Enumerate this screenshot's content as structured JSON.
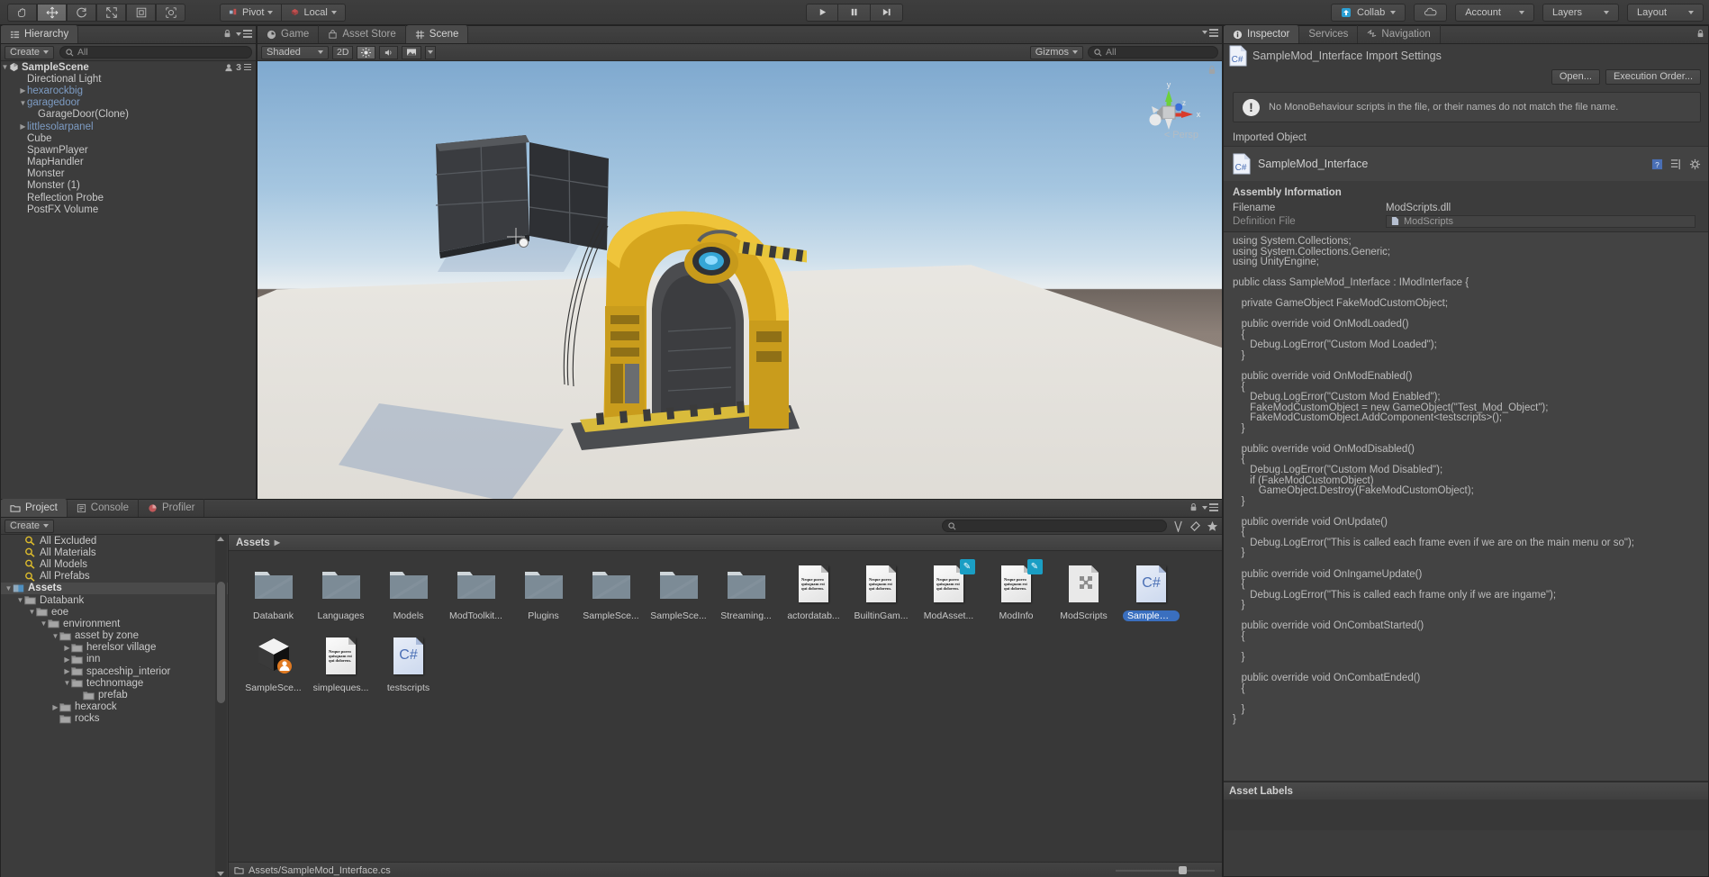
{
  "toolbar": {
    "tools": [
      {
        "name": "hand-tool",
        "glyph": "✋"
      },
      {
        "name": "move-tool",
        "glyph": "✥"
      },
      {
        "name": "rotate-tool",
        "glyph": "⟳"
      },
      {
        "name": "scale-tool",
        "glyph": "⤡"
      },
      {
        "name": "rect-tool",
        "glyph": "▣"
      },
      {
        "name": "transform-tool",
        "glyph": "◎"
      }
    ],
    "pivot_label": "Pivot",
    "local_label": "Local",
    "play_label": "▶",
    "pause_label": "❚❚",
    "step_label": "▶❙",
    "collab_label": "Collab",
    "cloud_label": "",
    "account_label": "Account",
    "layers_label": "Layers",
    "layout_label": "Layout"
  },
  "hierarchy": {
    "tab_label": "Hierarchy",
    "create_label": "Create",
    "search_placeholder": "All",
    "scene_count": "3",
    "scene_name": "SampleScene",
    "items": [
      {
        "label": "Directional Light",
        "indent": 1,
        "arrow": "",
        "prefab": false
      },
      {
        "label": "hexarockbig",
        "indent": 1,
        "arrow": "▶",
        "prefab": true
      },
      {
        "label": "garagedoor",
        "indent": 1,
        "arrow": "▼",
        "prefab": true
      },
      {
        "label": "GarageDoor(Clone)",
        "indent": 2,
        "arrow": "",
        "prefab": false
      },
      {
        "label": "littlesolarpanel",
        "indent": 1,
        "arrow": "▶",
        "prefab": true
      },
      {
        "label": "Cube",
        "indent": 1,
        "arrow": "",
        "prefab": false
      },
      {
        "label": "SpawnPlayer",
        "indent": 1,
        "arrow": "",
        "prefab": false
      },
      {
        "label": "MapHandler",
        "indent": 1,
        "arrow": "",
        "prefab": false
      },
      {
        "label": "Monster",
        "indent": 1,
        "arrow": "",
        "prefab": false
      },
      {
        "label": "Monster (1)",
        "indent": 1,
        "arrow": "",
        "prefab": false
      },
      {
        "label": "Reflection Probe",
        "indent": 1,
        "arrow": "",
        "prefab": false
      },
      {
        "label": "PostFX Volume",
        "indent": 1,
        "arrow": "",
        "prefab": false
      }
    ]
  },
  "scene": {
    "tabs": [
      {
        "label": "Game",
        "active": false
      },
      {
        "label": "Asset Store",
        "active": false
      },
      {
        "label": "Scene",
        "active": true
      }
    ],
    "shading_mode": "Shaded",
    "mode_2d": "2D",
    "gizmos_label": "Gizmos",
    "search_placeholder": "All",
    "persp_label": "Persp",
    "axis_x": "x",
    "axis_y": "y",
    "axis_z": "z"
  },
  "inspector": {
    "tabs": [
      {
        "label": "Inspector",
        "active": true
      },
      {
        "label": "Services",
        "active": false
      },
      {
        "label": "Navigation",
        "active": false
      }
    ],
    "title": "SampleMod_Interface Import Settings",
    "open_button": "Open...",
    "execution_order_button": "Execution Order...",
    "warning_text": "No MonoBehaviour scripts in the file, or their names do not match the file name.",
    "imported_object_header": "Imported Object",
    "imported_object_name": "SampleMod_Interface",
    "assembly_header": "Assembly Information",
    "filename_label": "Filename",
    "filename_value": "ModScripts.dll",
    "definition_file_label": "Definition File",
    "definition_file_value": "ModScripts",
    "asset_labels_header": "Asset Labels",
    "code": "using System.Collections;\nusing System.Collections.Generic;\nusing UnityEngine;\n\npublic class SampleMod_Interface : IModInterface {\n\n   private GameObject FakeModCustomObject;\n\n   public override void OnModLoaded()\n   {\n      Debug.LogError(\"Custom Mod Loaded\");\n   }\n\n   public override void OnModEnabled()\n   {\n      Debug.LogError(\"Custom Mod Enabled\");\n      FakeModCustomObject = new GameObject(\"Test_Mod_Object\");\n      FakeModCustomObject.AddComponent<testscripts>();\n   }\n\n   public override void OnModDisabled()\n   {\n      Debug.LogError(\"Custom Mod Disabled\");\n      if (FakeModCustomObject)\n         GameObject.Destroy(FakeModCustomObject);\n   }\n\n   public override void OnUpdate()\n   {\n      Debug.LogError(\"This is called each frame even if we are on the main menu or so\");\n   }\n\n   public override void OnIngameUpdate()\n   {\n      Debug.LogError(\"This is called each frame only if we are ingame\");\n   }\n\n   public override void OnCombatStarted()\n   {\n\n   }\n\n   public override void OnCombatEnded()\n   {\n\n   }\n}"
  },
  "project": {
    "tabs": [
      {
        "label": "Project",
        "active": true
      },
      {
        "label": "Console",
        "active": false
      },
      {
        "label": "Profiler",
        "active": false
      }
    ],
    "create_label": "Create",
    "search_placeholder": "",
    "breadcrumb": "Assets",
    "tree": [
      {
        "label": "All Excluded",
        "indent": 1,
        "arrow": "",
        "type": "search",
        "selected": false
      },
      {
        "label": "All Materials",
        "indent": 1,
        "arrow": "",
        "type": "search",
        "selected": false
      },
      {
        "label": "All Models",
        "indent": 1,
        "arrow": "",
        "type": "search",
        "selected": false
      },
      {
        "label": "All Prefabs",
        "indent": 1,
        "arrow": "",
        "type": "search",
        "selected": false
      },
      {
        "label": "Assets",
        "indent": 0,
        "arrow": "▼",
        "type": "assets",
        "selected": true
      },
      {
        "label": "Databank",
        "indent": 1,
        "arrow": "▼",
        "type": "folder",
        "selected": false
      },
      {
        "label": "eoe",
        "indent": 2,
        "arrow": "▼",
        "type": "folder",
        "selected": false
      },
      {
        "label": "environment",
        "indent": 3,
        "arrow": "▼",
        "type": "folder",
        "selected": false
      },
      {
        "label": "asset by zone",
        "indent": 4,
        "arrow": "▼",
        "type": "folder",
        "selected": false
      },
      {
        "label": "herelsor village",
        "indent": 5,
        "arrow": "▶",
        "type": "folder",
        "selected": false
      },
      {
        "label": "inn",
        "indent": 5,
        "arrow": "▶",
        "type": "folder",
        "selected": false
      },
      {
        "label": "spaceship_interior",
        "indent": 5,
        "arrow": "▶",
        "type": "folder",
        "selected": false
      },
      {
        "label": "technomage",
        "indent": 5,
        "arrow": "▼",
        "type": "folder",
        "selected": false
      },
      {
        "label": "prefab",
        "indent": 6,
        "arrow": "",
        "type": "folder",
        "selected": false
      },
      {
        "label": "hexarock",
        "indent": 4,
        "arrow": "▶",
        "type": "folder",
        "selected": false
      },
      {
        "label": "rocks",
        "indent": 4,
        "arrow": "",
        "type": "folder",
        "selected": false
      }
    ],
    "assets": [
      {
        "label": "Databank",
        "type": "folder",
        "selected": false
      },
      {
        "label": "Languages",
        "type": "folder",
        "selected": false
      },
      {
        "label": "Models",
        "type": "folder",
        "selected": false
      },
      {
        "label": "ModToolkit...",
        "type": "folder",
        "selected": false
      },
      {
        "label": "Plugins",
        "type": "folder",
        "selected": false
      },
      {
        "label": "SampleSce...",
        "type": "folder",
        "selected": false
      },
      {
        "label": "SampleSce...",
        "type": "folder",
        "selected": false
      },
      {
        "label": "Streaming...",
        "type": "folder",
        "selected": false
      },
      {
        "label": "actordatab...",
        "type": "document",
        "selected": false
      },
      {
        "label": "BuiltinGam...",
        "type": "document",
        "selected": false
      },
      {
        "label": "ModAsset...",
        "type": "document-edit",
        "selected": false
      },
      {
        "label": "ModInfo",
        "type": "document-edit",
        "selected": false
      },
      {
        "label": "ModScripts",
        "type": "assembly",
        "selected": false
      },
      {
        "label": "SampleMod...",
        "type": "csharp",
        "selected": true
      },
      {
        "label": "SampleSce...",
        "type": "unity-scene",
        "selected": false
      },
      {
        "label": "simpleques...",
        "type": "document",
        "selected": false
      },
      {
        "label": "testscripts",
        "type": "csharp",
        "selected": false
      }
    ],
    "doc_thumb_text": "Neque porro quisquam est qui dolorem.",
    "status_path": "Assets/SampleMod_Interface.cs"
  }
}
